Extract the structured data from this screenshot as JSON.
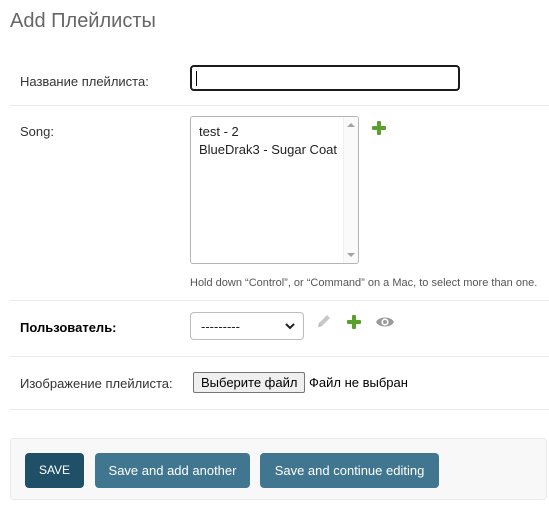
{
  "page": {
    "title": "Add Плейлисты"
  },
  "fields": {
    "name": {
      "label": "Название плейлиста:",
      "value": ""
    },
    "song": {
      "label": "Song:",
      "options": [
        "test - 2",
        "BlueDrak3 - Sugar Coat"
      ],
      "help": "Hold down “Control”, or “Command” on a Mac, to select more than one.",
      "add_icon": "plus-icon"
    },
    "user": {
      "label": "Пользователь:",
      "selected": "---------",
      "icons": [
        "pencil-icon",
        "plus-icon",
        "eye-icon"
      ]
    },
    "image": {
      "label": "Изображение плейлиста:",
      "button_label": "Выберите файл",
      "status": "Файл не выбран"
    }
  },
  "actions": {
    "save": "SAVE",
    "save_add_another": "Save and add another",
    "save_continue": "Save and continue editing"
  },
  "colors": {
    "save_button": "#205067",
    "secondary_button": "#417690",
    "add_icon": "#5aa02c"
  }
}
